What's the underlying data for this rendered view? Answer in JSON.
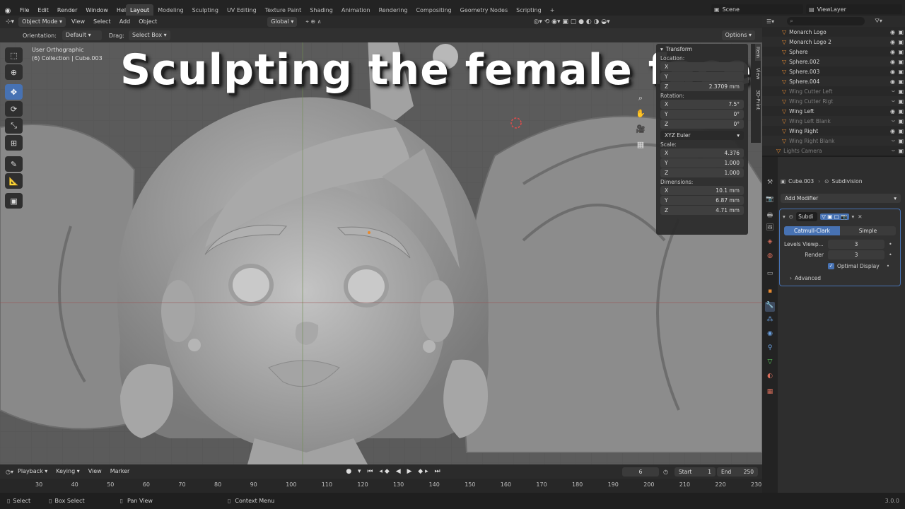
{
  "menu": {
    "logo": "blender-icon",
    "items": [
      "File",
      "Edit",
      "Render",
      "Window",
      "Help"
    ]
  },
  "workspaces": [
    "Layout",
    "Modeling",
    "Sculpting",
    "UV Editing",
    "Texture Paint",
    "Shading",
    "Animation",
    "Rendering",
    "Compositing",
    "Geometry Nodes",
    "Scripting"
  ],
  "workspace_add": "+",
  "scene": {
    "label": "Scene",
    "viewlayer": "ViewLayer"
  },
  "header": {
    "mode": "Object Mode",
    "view": "View",
    "select": "Select",
    "add": "Add",
    "object": "Object",
    "transform_space": "Global",
    "orientation_label": "Orientation:",
    "orientation_value": "Default",
    "drag_label": "Drag:",
    "drag_value": "Select Box",
    "options": "Options"
  },
  "viewport": {
    "view_name": "User Orthographic",
    "collection": "(6) Collection | Cube.003",
    "overlay_title": "Sculpting the female face"
  },
  "npanel": {
    "title": "Transform",
    "location_label": "Location:",
    "location": {
      "z": "2.3709 mm"
    },
    "rotation_label": "Rotation:",
    "rotation": {
      "x": "7.5°",
      "y": "0°",
      "z": "0°"
    },
    "rotation_mode": "XYZ Euler",
    "scale_label": "Scale:",
    "scale": {
      "x": "4.376",
      "y": "1.000",
      "z": "1.000"
    },
    "dimensions_label": "Dimensions:",
    "dimensions": {
      "x": "10.1 mm",
      "y": "6.87 mm",
      "z": "4.71 mm"
    },
    "axis": {
      "x": "X",
      "y": "Y",
      "z": "Z"
    },
    "tabs": [
      "Item",
      "View",
      "3D-Print"
    ]
  },
  "outliner": {
    "rows": [
      {
        "name": "Monarch Logo",
        "dim": false
      },
      {
        "name": "Monarch Logo 2",
        "dim": false
      },
      {
        "name": "Sphere",
        "dim": false
      },
      {
        "name": "Sphere.002",
        "dim": false
      },
      {
        "name": "Sphere.003",
        "dim": false
      },
      {
        "name": "Sphere.004",
        "dim": false
      },
      {
        "name": "Wing Cutter Left",
        "dim": true
      },
      {
        "name": "Wing Cutter Rigt",
        "dim": true
      },
      {
        "name": "Wing Left",
        "dim": false
      },
      {
        "name": "Wing Left Blank",
        "dim": true
      },
      {
        "name": "Wing Right",
        "dim": false
      },
      {
        "name": "Wing Right Blank",
        "dim": true
      },
      {
        "name": "Lights Camera",
        "dim": true
      }
    ]
  },
  "properties": {
    "object": "Cube.003",
    "modifier_crumb": "Subdivision",
    "add_modifier": "Add Modifier",
    "modifier_name": "Subdi",
    "catmull": "Catmull-Clark",
    "simple": "Simple",
    "levels_label": "Levels Viewp...",
    "levels_value": "3",
    "render_label": "Render",
    "render_value": "3",
    "optimal": "Optimal Display",
    "advanced": "Advanced"
  },
  "timeline": {
    "playback": "Playback",
    "keying": "Keying",
    "view": "View",
    "marker": "Marker",
    "current_frame": "6",
    "start_label": "Start",
    "start": "1",
    "end_label": "End",
    "end": "250",
    "ticks": [
      "30",
      "40",
      "50",
      "60",
      "70",
      "80",
      "90",
      "100",
      "110",
      "120",
      "130",
      "140",
      "150",
      "160",
      "170",
      "180",
      "190",
      "200",
      "210",
      "220",
      "230"
    ]
  },
  "status": {
    "select": "Select",
    "box_select": "Box Select",
    "pan_view": "Pan View",
    "context_menu": "Context Menu",
    "version": "3.0.0"
  }
}
